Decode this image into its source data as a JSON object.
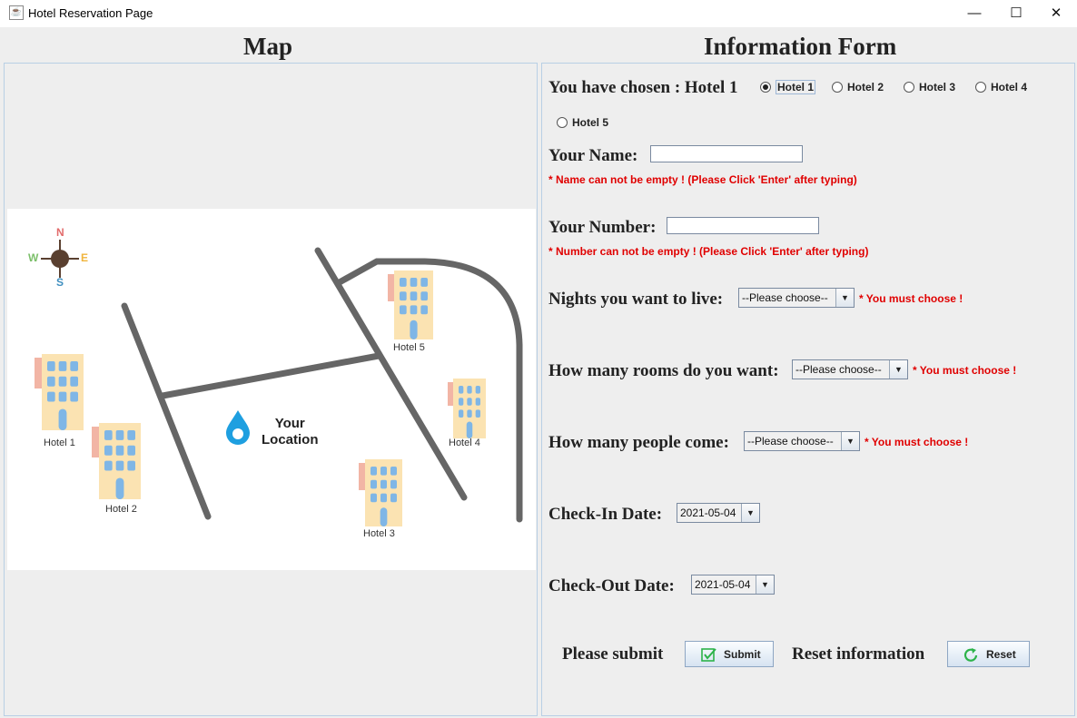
{
  "window": {
    "title": "Hotel Reservation Page",
    "minimize_glyph": "—",
    "maximize_glyph": "☐",
    "close_glyph": "✕",
    "icon_name": "java-cup-icon"
  },
  "map_section": {
    "title": "Map",
    "compass": {
      "n": "N",
      "s": "S",
      "w": "W",
      "e": "E"
    },
    "hotels": [
      "Hotel 1",
      "Hotel 2",
      "Hotel 3",
      "Hotel 4",
      "Hotel 5"
    ],
    "location_line1": "Your",
    "location_line2": "Location",
    "colors": {
      "road": "#666666",
      "hotel_wall": "#fbe3b2",
      "hotel_window": "#7fb6e6",
      "hotel_sign": "#f2b5a5",
      "location_pin": "#1e9fe0",
      "compass_body": "#5a4030",
      "compass_n": "#e26b6b",
      "compass_s": "#3f8fc0",
      "compass_w": "#7cbf6a",
      "compass_e": "#f0b43c"
    }
  },
  "form": {
    "title": "Information Form",
    "chosen_label": "You have chosen : Hotel 1",
    "hotel_options": [
      {
        "label": "Hotel 1",
        "selected": true
      },
      {
        "label": "Hotel 2",
        "selected": false
      },
      {
        "label": "Hotel 3",
        "selected": false
      },
      {
        "label": "Hotel 4",
        "selected": false
      },
      {
        "label": "Hotel 5",
        "selected": false
      }
    ],
    "name_label": "Your Name:",
    "name_value": "",
    "name_error": "* Name can not be empty ! (Please Click 'Enter' after typing)",
    "number_label": "Your Number:",
    "number_value": "",
    "number_error": "* Number can not be empty ! (Please Click 'Enter' after typing)",
    "nights_label": "Nights you want to live:",
    "nights_value": "--Please choose--",
    "nights_error": "* You must choose !",
    "rooms_label": "How many rooms do you want:",
    "rooms_value": "--Please choose--",
    "rooms_error": "* You must choose !",
    "people_label": "How many people come:",
    "people_value": "--Please choose--",
    "people_error": "* You must choose !",
    "checkin_label": "Check-In Date:",
    "checkin_value": "2021-05-04",
    "checkout_label": "Check-Out Date:",
    "checkout_value": "2021-05-04",
    "submit_caption": "Please submit",
    "submit_button": "Submit",
    "reset_caption": "Reset information",
    "reset_button": "Reset",
    "dropdown_arrow": "▼",
    "colors": {
      "error": "#e00000",
      "submit_icon": "#2db34a",
      "reset_icon": "#2db34a"
    }
  }
}
